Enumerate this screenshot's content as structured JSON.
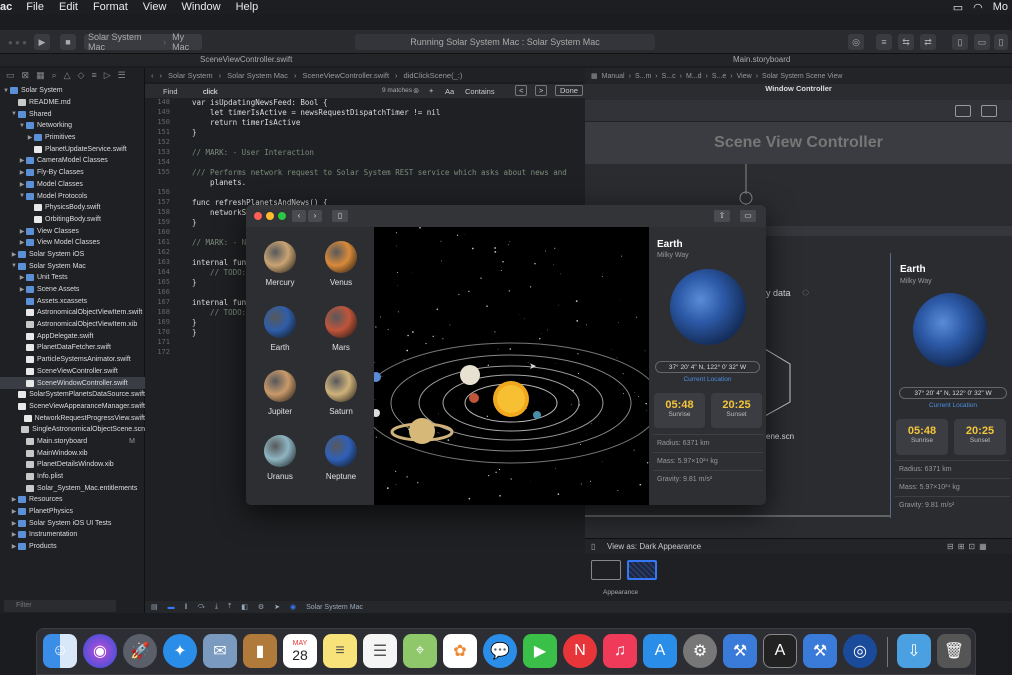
{
  "menubar": {
    "app": "ac",
    "items": [
      "File",
      "Edit",
      "Format",
      "View",
      "Window",
      "Help"
    ],
    "right_label": "Mo"
  },
  "toolbar": {
    "scheme": "Solar System Mac",
    "destination": "My Mac",
    "status": "Running Solar System Mac : Solar System Mac"
  },
  "tabs": {
    "left": "SceneViewController.swift",
    "right": "Main.storyboard"
  },
  "jumpbar": {
    "items": [
      "Solar System",
      "Solar System Mac",
      "SceneViewController.swift",
      "didClickScene(_:)"
    ]
  },
  "findbar": {
    "mode": "Find",
    "query": "click",
    "matches": "9 matches",
    "aa": "Aa",
    "contains": "Contains",
    "done": "Done"
  },
  "navigator": {
    "items": [
      {
        "label": "Solar System",
        "indent": 0,
        "kind": "project",
        "tw": "▼"
      },
      {
        "label": "README.md",
        "indent": 1,
        "kind": "file"
      },
      {
        "label": "Shared",
        "indent": 1,
        "kind": "folder",
        "tw": "▼"
      },
      {
        "label": "Networking",
        "indent": 2,
        "kind": "folder",
        "tw": "▼"
      },
      {
        "label": "Primitives",
        "indent": 3,
        "kind": "folder",
        "tw": "▶"
      },
      {
        "label": "PlanetUpdateService.swift",
        "indent": 3,
        "kind": "swift"
      },
      {
        "label": "CameraModel Classes",
        "indent": 2,
        "kind": "folder",
        "tw": "▶"
      },
      {
        "label": "Fly-By Classes",
        "indent": 2,
        "kind": "folder",
        "tw": "▶"
      },
      {
        "label": "Model Classes",
        "indent": 2,
        "kind": "folder",
        "tw": "▶"
      },
      {
        "label": "Model Protocols",
        "indent": 2,
        "kind": "folder",
        "tw": "▼"
      },
      {
        "label": "PhysicsBody.swift",
        "indent": 3,
        "kind": "swift"
      },
      {
        "label": "OrbitingBody.swift",
        "indent": 3,
        "kind": "swift"
      },
      {
        "label": "View Classes",
        "indent": 2,
        "kind": "folder",
        "tw": "▶"
      },
      {
        "label": "View Model Classes",
        "indent": 2,
        "kind": "folder",
        "tw": "▶"
      },
      {
        "label": "Solar System iOS",
        "indent": 1,
        "kind": "folder",
        "tw": "▶"
      },
      {
        "label": "Solar System Mac",
        "indent": 1,
        "kind": "folder",
        "tw": "▼"
      },
      {
        "label": "Unit Tests",
        "indent": 2,
        "kind": "folder",
        "tw": "▶"
      },
      {
        "label": "Scene Assets",
        "indent": 2,
        "kind": "folder",
        "tw": "▶"
      },
      {
        "label": "Assets.xcassets",
        "indent": 2,
        "kind": "folder"
      },
      {
        "label": "AstronomicalObjectViewItem.swift",
        "indent": 2,
        "kind": "swift"
      },
      {
        "label": "AstronomicalObjectViewItem.xib",
        "indent": 2,
        "kind": "file"
      },
      {
        "label": "AppDelegate.swift",
        "indent": 2,
        "kind": "swift"
      },
      {
        "label": "PlanetDataFetcher.swift",
        "indent": 2,
        "kind": "swift"
      },
      {
        "label": "ParticleSystemsAnimator.swift",
        "indent": 2,
        "kind": "swift"
      },
      {
        "label": "SceneViewController.swift",
        "indent": 2,
        "kind": "swift"
      },
      {
        "label": "SceneWindowController.swift",
        "indent": 2,
        "kind": "swift",
        "selected": true
      },
      {
        "label": "SolarSystemPlanetsDataSource.swift",
        "indent": 2,
        "kind": "swift"
      },
      {
        "label": "SceneViewAppearanceManager.swift",
        "indent": 2,
        "kind": "swift"
      },
      {
        "label": "NetworkRequestProgressView.swift",
        "indent": 2,
        "kind": "swift"
      },
      {
        "label": "SingleAstronomicalObjectScene.scn",
        "indent": 2,
        "kind": "file"
      },
      {
        "label": "Main.storyboard",
        "indent": 2,
        "kind": "file",
        "badge": "M"
      },
      {
        "label": "MainWindow.xib",
        "indent": 2,
        "kind": "file"
      },
      {
        "label": "PlanetDetailsWindow.xib",
        "indent": 2,
        "kind": "file"
      },
      {
        "label": "Info.plist",
        "indent": 2,
        "kind": "file"
      },
      {
        "label": "Solar_System_Mac.entitlements",
        "indent": 2,
        "kind": "file"
      },
      {
        "label": "Resources",
        "indent": 1,
        "kind": "folder",
        "tw": "▶"
      },
      {
        "label": "PlanetPhysics",
        "indent": 1,
        "kind": "folder",
        "tw": "▶"
      },
      {
        "label": "Solar System iOS UI Tests",
        "indent": 1,
        "kind": "folder",
        "tw": "▶"
      },
      {
        "label": "Instrumentation",
        "indent": 1,
        "kind": "folder",
        "tw": "▶"
      },
      {
        "label": "Products",
        "indent": 1,
        "kind": "folder",
        "tw": "▶"
      }
    ],
    "filter_placeholder": "Filter"
  },
  "code": {
    "lines": [
      {
        "n": "148",
        "t": "var isUpdatingNewsFeed: Bool {"
      },
      {
        "n": "149",
        "t": "    let timerIsActive = newsRequestDispatchTimer != nil"
      },
      {
        "n": "150",
        "t": "    return timerIsActive"
      },
      {
        "n": "151",
        "t": "}"
      },
      {
        "n": "152",
        "t": ""
      },
      {
        "n": "153",
        "t": "// MARK: - User Interaction"
      },
      {
        "n": "154",
        "t": ""
      },
      {
        "n": "155",
        "t": "/// Performs network request to Solar System REST service which asks about news and"
      },
      {
        "n": "",
        "t": "    planets."
      },
      {
        "n": "156",
        "t": ""
      },
      {
        "n": "157",
        "t": "func refreshPlanetsAndNews() {"
      },
      {
        "n": "158",
        "t": "    networkS"
      },
      {
        "n": "159",
        "t": "}"
      },
      {
        "n": "160",
        "t": ""
      },
      {
        "n": "161",
        "t": "// MARK: - N"
      },
      {
        "n": "162",
        "t": ""
      },
      {
        "n": "163",
        "t": "internal fun"
      },
      {
        "n": "164",
        "t": "    // TODO:"
      },
      {
        "n": "165",
        "t": "}"
      },
      {
        "n": "166",
        "t": ""
      },
      {
        "n": "167",
        "t": "internal fun"
      },
      {
        "n": "168",
        "t": "    // TODO:"
      },
      {
        "n": "169",
        "t": "}"
      },
      {
        "n": "170",
        "t": "}"
      },
      {
        "n": "171",
        "t": ""
      },
      {
        "n": "172",
        "t": ""
      }
    ]
  },
  "storyboard": {
    "tabs": [
      "Manual",
      "S...m",
      "S...c",
      "M...d",
      "S...e",
      "View",
      "Solar System Scene View"
    ],
    "window_controller": "Window Controller",
    "scene_vc": "Scene View Controller",
    "partial_data": "y data",
    "partial_scn": "ene.scn",
    "view_as": "View as: Dark Appearance",
    "appearance": "Appearance"
  },
  "appwin": {
    "planets": [
      {
        "name": "Mercury",
        "color": "#c9a473"
      },
      {
        "name": "Venus",
        "color": "#d98a3a"
      },
      {
        "name": "Earth",
        "color": "#2f5ea8"
      },
      {
        "name": "Mars",
        "color": "#c0553a"
      },
      {
        "name": "Jupiter",
        "color": "#c99a6a"
      },
      {
        "name": "Saturn",
        "color": "#cfb27a"
      },
      {
        "name": "Uranus",
        "color": "#8fb5c2"
      },
      {
        "name": "Neptune",
        "color": "#3060b8"
      }
    ]
  },
  "detail": {
    "title": "Earth",
    "subtitle": "Milky Way",
    "coords": "37° 20' 4\" N, 122° 0' 32\" W",
    "current_location": "Current Location",
    "sunrise_time": "05:48",
    "sunrise_label": "Sunrise",
    "sunset_time": "20:25",
    "sunset_label": "Sunset",
    "radius": "Radius: 6371 km",
    "mass": "Mass: 5.97×10²⁴ kg",
    "gravity": "Gravity: 9.81 m/s²"
  },
  "debug": {
    "target": "Solar System Mac"
  },
  "dock": {
    "calendar_month": "MAY",
    "calendar_day": "28"
  }
}
